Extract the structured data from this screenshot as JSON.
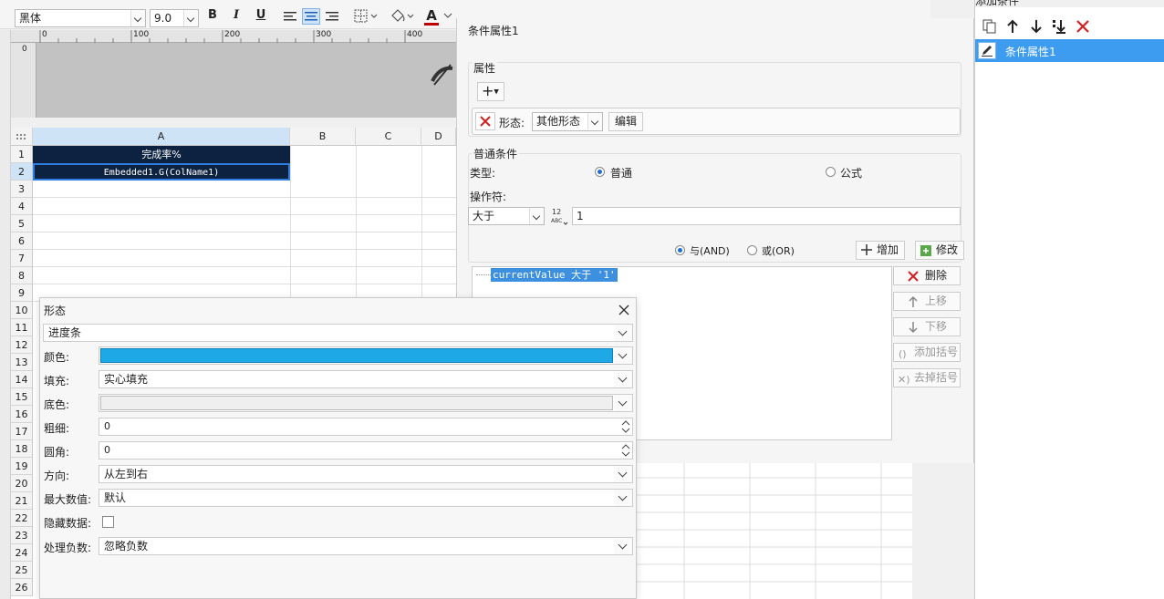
{
  "toolbar": {
    "font_name": "黑体",
    "font_size": "9.0",
    "bold": "B",
    "italic": "I",
    "underline": "U",
    "font_color_glyph": "A"
  },
  "ruler": {
    "marks": [
      "0",
      "100",
      "200",
      "300",
      "400"
    ],
    "vertical_mark": "0"
  },
  "sheet": {
    "columns": [
      "A",
      "B",
      "C",
      "D"
    ],
    "rows": [
      "1",
      "2",
      "3",
      "4",
      "5",
      "6",
      "7",
      "8",
      "9",
      "10",
      "11",
      "12",
      "13",
      "14",
      "15",
      "16",
      "17",
      "18",
      "19",
      "20",
      "21",
      "22",
      "23",
      "24",
      "25",
      "26"
    ],
    "cell_a1": "完成率%",
    "cell_a2": "Embedded1.G(ColName1)",
    "colors": {
      "header_fill": "#0d2240",
      "header_text": "#ffffff"
    }
  },
  "condition_panel": {
    "title": "条件属性1",
    "attributes_label": "属性",
    "add_symbol": "+",
    "shape_label": "形态:",
    "shape_value": "其他形态",
    "edit_button": "编辑",
    "normal_condition_label": "普通条件",
    "type_label": "类型:",
    "type_normal": "普通",
    "type_formula": "公式",
    "operator_label": "操作符:",
    "operator_value": "大于",
    "operand_value": "1",
    "and_label": "与(AND)",
    "or_label": "或(OR)",
    "add_button": "增加",
    "modify_button": "修改",
    "condition_expr": "currentValue 大于 '1'",
    "delete_button": "删除",
    "move_up_button": "上移",
    "move_down_button": "下移",
    "add_bracket_button": "添加括号",
    "remove_bracket_button": "去掉括号"
  },
  "right_panel": {
    "header": "添加条件",
    "item": "条件属性1",
    "colors": {
      "selected": "#3d9cf0"
    }
  },
  "shape_dialog": {
    "title": "形态",
    "type_value": "进度条",
    "color_label": "颜色:",
    "color_value": "#1ea9e6",
    "fill_label": "填充:",
    "fill_value": "实心填充",
    "bg_label": "底色:",
    "thickness_label": "粗细:",
    "thickness_value": "0",
    "radius_label": "圆角:",
    "radius_value": "0",
    "direction_label": "方向:",
    "direction_value": "从左到右",
    "max_label": "最大数值:",
    "max_value": "默认",
    "hide_label": "隐藏数据:",
    "negative_label": "处理负数:",
    "negative_value": "忽略负数"
  }
}
